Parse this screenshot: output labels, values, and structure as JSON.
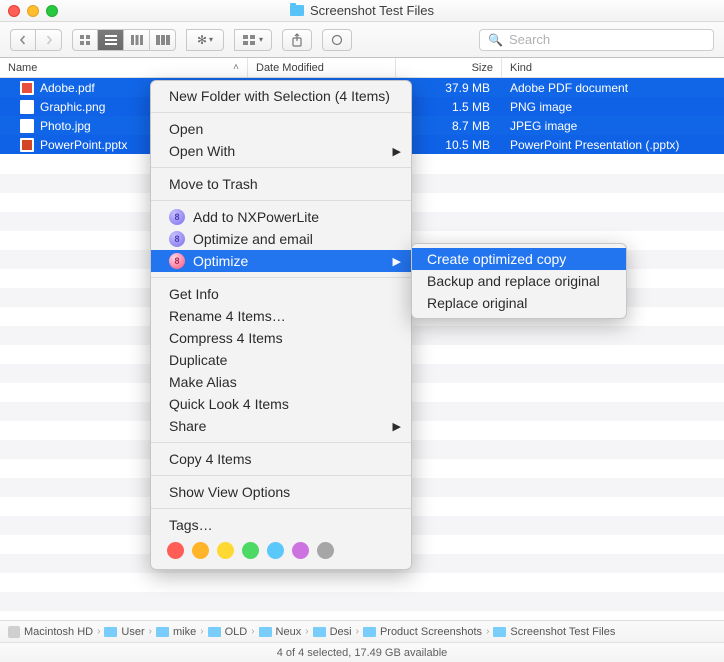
{
  "window": {
    "title": "Screenshot Test Files"
  },
  "search": {
    "placeholder": "Search"
  },
  "columns": {
    "name": "Name",
    "date": "Date Modified",
    "size": "Size",
    "kind": "Kind"
  },
  "files": [
    {
      "name": "Adobe.pdf",
      "size": "37.9 MB",
      "kind": "Adobe PDF document",
      "icon": "pdf"
    },
    {
      "name": "Graphic.png",
      "size": "1.5 MB",
      "kind": "PNG image",
      "icon": "png"
    },
    {
      "name": "Photo.jpg",
      "size": "8.7 MB",
      "kind": "JPEG image",
      "icon": "jpg"
    },
    {
      "name": "PowerPoint.pptx",
      "size": "10.5 MB",
      "kind": "PowerPoint Presentation (.pptx)",
      "icon": "pptx"
    }
  ],
  "context_menu": {
    "new_folder": "New Folder with Selection (4 Items)",
    "open": "Open",
    "open_with": "Open With",
    "move_to_trash": "Move to Trash",
    "add_nxp": "Add to NXPowerLite",
    "optimize_email": "Optimize and email",
    "optimize": "Optimize",
    "get_info": "Get Info",
    "rename": "Rename 4 Items…",
    "compress": "Compress 4 Items",
    "duplicate": "Duplicate",
    "make_alias": "Make Alias",
    "quick_look": "Quick Look 4 Items",
    "share": "Share",
    "copy": "Copy 4 Items",
    "view_options": "Show View Options",
    "tags": "Tags…"
  },
  "submenu": {
    "create_copy": "Create optimized copy",
    "backup_replace": "Backup and replace original",
    "replace": "Replace original"
  },
  "tag_colors": [
    "#ff5e56",
    "#ffb429",
    "#ffd933",
    "#4cd964",
    "#5ac8fa",
    "#cc73e1",
    "#a6a6a6"
  ],
  "path": [
    "Macintosh HD",
    "User",
    "mike",
    "OLD",
    "Neux",
    "Desi",
    "Product Screenshots",
    "Screenshot Test Files"
  ],
  "status": "4 of 4 selected, 17.49 GB available"
}
